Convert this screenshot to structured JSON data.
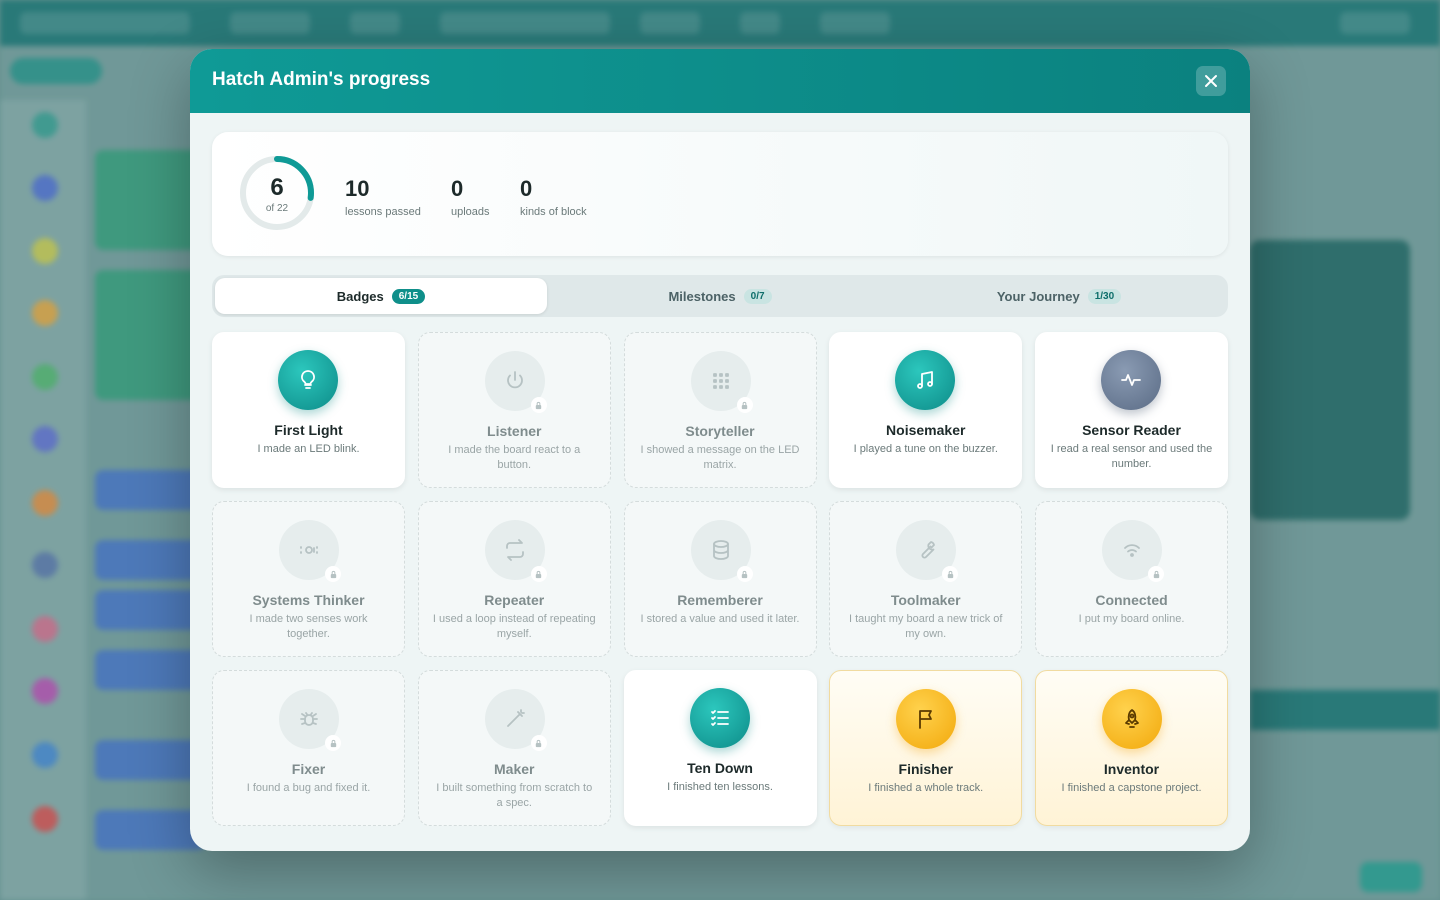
{
  "modal": {
    "title": "Hatch Admin's progress"
  },
  "summary": {
    "ring_value": "6",
    "ring_sub": "of 22",
    "ring_fraction": 0.2727,
    "stats": [
      {
        "value": "10",
        "label": "lessons passed"
      },
      {
        "value": "0",
        "label": "uploads"
      },
      {
        "value": "0",
        "label": "kinds of block"
      }
    ]
  },
  "tabs": [
    {
      "label": "Badges",
      "count": "6/15",
      "active": true
    },
    {
      "label": "Milestones",
      "count": "0/7",
      "active": false
    },
    {
      "label": "Your Journey",
      "count": "1/30",
      "active": false
    }
  ],
  "badges": [
    {
      "title": "First Light",
      "desc": "I made an LED blink.",
      "state": "earned",
      "icon": "lightbulb-icon",
      "tone": "teal"
    },
    {
      "title": "Listener",
      "desc": "I made the board react to a button.",
      "state": "locked",
      "icon": "power-icon"
    },
    {
      "title": "Storyteller",
      "desc": "I showed a message on the LED matrix.",
      "state": "locked",
      "icon": "grid-icon"
    },
    {
      "title": "Noisemaker",
      "desc": "I played a tune on the buzzer.",
      "state": "earned",
      "icon": "music-note-icon",
      "tone": "teal"
    },
    {
      "title": "Sensor Reader",
      "desc": "I read a real sensor and used the number.",
      "state": "earned",
      "icon": "pulse-icon",
      "tone": "slate"
    },
    {
      "title": "Systems Thinker",
      "desc": "I made two senses work together.",
      "state": "locked",
      "icon": "radar-icon"
    },
    {
      "title": "Repeater",
      "desc": "I used a loop instead of repeating myself.",
      "state": "locked",
      "icon": "repeat-icon"
    },
    {
      "title": "Rememberer",
      "desc": "I stored a value and used it later.",
      "state": "locked",
      "icon": "database-icon"
    },
    {
      "title": "Toolmaker",
      "desc": "I taught my board a new trick of my own.",
      "state": "locked",
      "icon": "wrench-icon"
    },
    {
      "title": "Connected",
      "desc": "I put my board online.",
      "state": "locked",
      "icon": "wifi-icon"
    },
    {
      "title": "Fixer",
      "desc": "I found a bug and fixed it.",
      "state": "locked",
      "icon": "bug-icon"
    },
    {
      "title": "Maker",
      "desc": "I built something from scratch to a spec.",
      "state": "locked",
      "icon": "wand-icon"
    },
    {
      "title": "Ten Down",
      "desc": "I finished ten lessons.",
      "state": "earned",
      "icon": "checklist-icon",
      "tone": "teal"
    },
    {
      "title": "Finisher",
      "desc": "I finished a whole track.",
      "state": "gold",
      "icon": "flag-icon"
    },
    {
      "title": "Inventor",
      "desc": "I finished a capstone project.",
      "state": "gold",
      "icon": "rocket-icon"
    }
  ],
  "colors": {
    "accent": "#0f9a96",
    "gold": "#f2a80b",
    "locked": "#e6eded"
  }
}
